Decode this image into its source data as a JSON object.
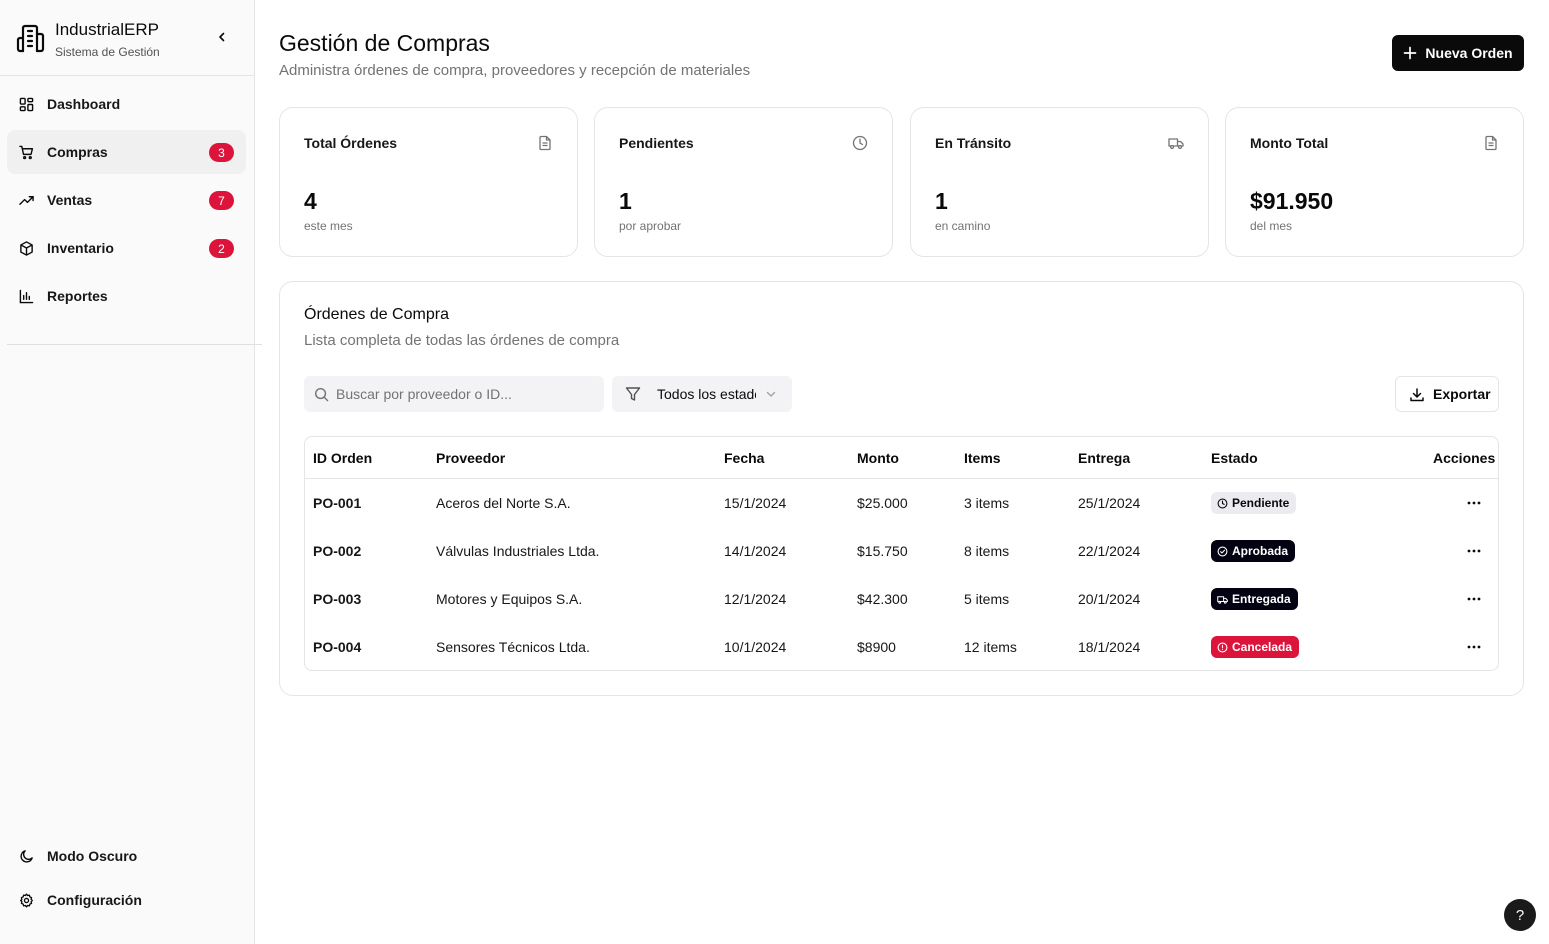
{
  "brand": {
    "title": "IndustrialERP",
    "subtitle": "Sistema de Gestión",
    "icon": "building-icon"
  },
  "sidebar": {
    "items": [
      {
        "label": "Dashboard",
        "icon": "layout-grid-icon",
        "badge": null,
        "active": false
      },
      {
        "label": "Compras",
        "icon": "cart-icon",
        "badge": "3",
        "active": true
      },
      {
        "label": "Ventas",
        "icon": "trending-up-icon",
        "badge": "7",
        "active": false
      },
      {
        "label": "Inventario",
        "icon": "package-icon",
        "badge": "2",
        "active": false
      },
      {
        "label": "Reportes",
        "icon": "bar-chart-icon",
        "badge": null,
        "active": false
      }
    ],
    "bottom": [
      {
        "label": "Modo Oscuro",
        "icon": "moon-icon"
      },
      {
        "label": "Configuración",
        "icon": "gear-icon"
      }
    ]
  },
  "header": {
    "title": "Gestión de Compras",
    "subtitle": "Administra órdenes de compra, proveedores y recepción de materiales",
    "new_order_label": "Nueva Orden"
  },
  "stats": [
    {
      "title": "Total Órdenes",
      "value": "4",
      "note": "este mes",
      "icon": "file-icon"
    },
    {
      "title": "Pendientes",
      "value": "1",
      "note": "por aprobar",
      "icon": "clock-icon"
    },
    {
      "title": "En Tránsito",
      "value": "1",
      "note": "en camino",
      "icon": "truck-icon"
    },
    {
      "title": "Monto Total",
      "value": "$91.950",
      "note": "del mes",
      "icon": "file-icon"
    }
  ],
  "orders": {
    "title": "Órdenes de Compra",
    "subtitle": "Lista completa de todas las órdenes de compra",
    "search_placeholder": "Buscar por proveedor o ID...",
    "search_value": "",
    "filter_label": "Todos los estados",
    "export_label": "Exportar",
    "columns": [
      "ID Orden",
      "Proveedor",
      "Fecha",
      "Monto",
      "Items",
      "Entrega",
      "Estado",
      "Acciones"
    ],
    "rows": [
      {
        "id": "PO-001",
        "supplier": "Aceros del Norte S.A.",
        "date": "15/1/2024",
        "amount": "$25.000",
        "items": "3 items",
        "delivery": "25/1/2024",
        "status": "Pendiente",
        "status_type": "pending"
      },
      {
        "id": "PO-002",
        "supplier": "Válvulas Industriales Ltda.",
        "date": "14/1/2024",
        "amount": "$15.750",
        "items": "8 items",
        "delivery": "22/1/2024",
        "status": "Aprobada",
        "status_type": "approved"
      },
      {
        "id": "PO-003",
        "supplier": "Motores y Equipos S.A.",
        "date": "12/1/2024",
        "amount": "$42.300",
        "items": "5 items",
        "delivery": "20/1/2024",
        "status": "Entregada",
        "status_type": "delivered"
      },
      {
        "id": "PO-004",
        "supplier": "Sensores Técnicos Ltda.",
        "date": "10/1/2024",
        "amount": "$8900",
        "items": "12 items",
        "delivery": "18/1/2024",
        "status": "Cancelada",
        "status_type": "cancelled"
      }
    ]
  },
  "help_label": "?",
  "colors": {
    "accent": "#0a0a0a",
    "badge_red": "#dc143c",
    "muted": "#737373"
  }
}
